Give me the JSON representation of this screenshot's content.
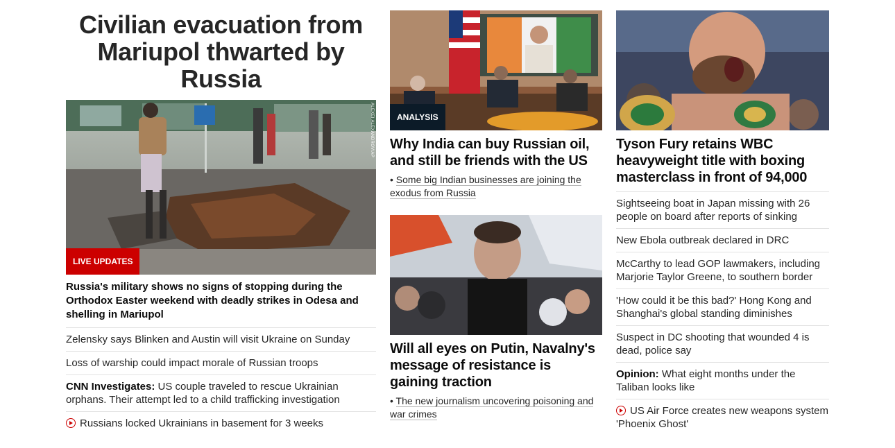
{
  "column1": {
    "banner": "Civilian evacuation from Mariupol thwarted by Russia",
    "photo_credit": "ALEXEI ALEXANDROV/AP",
    "badge": "LIVE UPDATES",
    "lead_headline": "Russia's military shows no signs of stopping during the Orthodox Easter weekend with deadly strikes in Odesa and shelling in Mariupol",
    "items": [
      {
        "text": "Zelensky says Blinken and Austin will visit Ukraine on Sunday"
      },
      {
        "text": "Loss of warship could impact morale of Russian troops"
      },
      {
        "prefix": "CNN Investigates:",
        "text": " US couple traveled to rescue Ukrainian orphans. Their attempt led to a child trafficking investigation"
      },
      {
        "icon": "play-icon",
        "text": "Russians locked Ukrainians in basement for 3 weeks"
      }
    ]
  },
  "column2": {
    "story1": {
      "badge": "ANALYSIS",
      "headline": "Why India can buy Russian oil, and still be friends with the US",
      "related": "Some big Indian businesses are joining the exodus from Russia"
    },
    "story2": {
      "headline": "Will all eyes on Putin, Navalny's message of resistance is gaining traction",
      "related": "The new journalism uncovering poisoning and war crimes"
    }
  },
  "column3": {
    "headline": "Tyson Fury retains WBC heavyweight title with boxing masterclass in front of 94,000",
    "items": [
      {
        "text": "Sightseeing boat in Japan missing with 26 people on board after reports of sinking"
      },
      {
        "text": "New Ebola outbreak declared in DRC"
      },
      {
        "text": "McCarthy to lead GOP lawmakers, including Marjorie Taylor Greene, to southern border"
      },
      {
        "text": "'How could it be this bad?' Hong Kong and Shanghai's global standing diminishes"
      },
      {
        "text": "Suspect in DC shooting that wounded 4 is dead, police say"
      },
      {
        "prefix": "Opinion:",
        "text": " What eight months under the Taliban looks like"
      },
      {
        "icon": "play-icon",
        "text": "US Air Force creates new weapons system 'Phoenix Ghost'"
      }
    ]
  },
  "colors": {
    "live_badge": "#cc0000",
    "analysis_badge": "#0c1b28",
    "divider": "#e2e2e2"
  }
}
